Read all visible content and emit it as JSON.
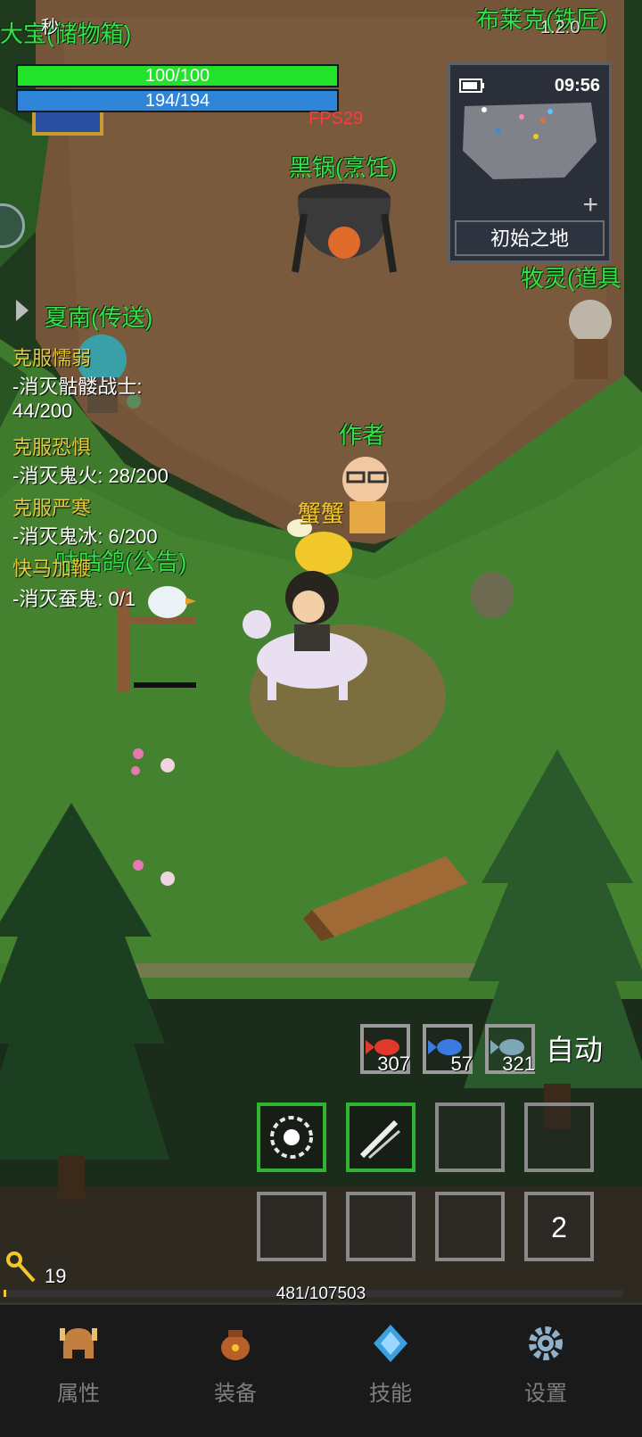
{
  "player": {
    "hp_text": "100/100",
    "mp_text": "194/194",
    "hp_fraction": 1.0,
    "mp_fraction": 1.0,
    "level": "19",
    "exp_text": "481/107503",
    "exp_fraction": 0.0045
  },
  "hud": {
    "version": "1.2.0",
    "fps": "FPS29",
    "top_left_small": "秒"
  },
  "minimap": {
    "time": "09:56",
    "plus": "+",
    "zone": "初始之地"
  },
  "npcs": {
    "storage": "大宝(储物箱)",
    "blacksmith": "布莱克(铁匠)",
    "cook": "黑锅(烹饪)",
    "items_shop": "牧灵(道具",
    "teleport": "夏南(传送)",
    "author": "作者",
    "notice": "咕咕鸽(公告)",
    "pet": "蟹蟹"
  },
  "quests": [
    {
      "title": "克服懦弱",
      "line1": "-消灭骷髅战士:",
      "line2": "44/200"
    },
    {
      "title": "克服恐惧",
      "line1": "-消灭鬼火: 28/200"
    },
    {
      "title": "克服严寒",
      "line1": "-消灭鬼冰: 6/200"
    },
    {
      "title": "快马加鞭",
      "line1": "-消灭蚕鬼: 0/1"
    }
  ],
  "consumables": [
    {
      "icon": "red-fish-icon",
      "count": "307",
      "color": "#e0392c"
    },
    {
      "icon": "blue-fish-icon",
      "count": "57",
      "color": "#3a7be0"
    },
    {
      "icon": "grey-fish-icon",
      "count": "321",
      "color": "#7fa6b5"
    }
  ],
  "auto_label": "自动",
  "skill_slots": [
    {
      "icon": "burst-skill-icon",
      "active": true
    },
    {
      "icon": "slash-skill-icon",
      "active": true
    },
    {
      "icon": "",
      "active": false
    },
    {
      "icon": "",
      "active": false
    },
    {
      "icon": "",
      "active": false
    },
    {
      "icon": "",
      "active": false
    },
    {
      "icon": "",
      "active": false
    },
    {
      "icon": "",
      "active": false,
      "label": "2"
    }
  ],
  "nav": [
    {
      "label": "属性",
      "icon": "helmet-icon"
    },
    {
      "label": "装备",
      "icon": "bag-icon"
    },
    {
      "label": "技能",
      "icon": "crystal-icon"
    },
    {
      "label": "设置",
      "icon": "gear-icon"
    }
  ],
  "colors": {
    "hp": "#22e22a",
    "mp": "#2f86d9",
    "npc_label": "#35e04a",
    "quest_title": "#e6c93a",
    "fps": "#ff3b3b"
  }
}
